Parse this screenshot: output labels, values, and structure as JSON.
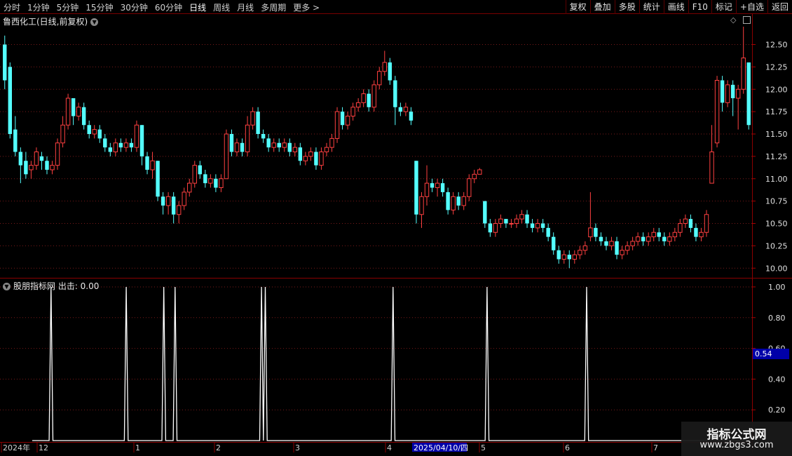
{
  "toolbar": {
    "periods": [
      "分时",
      "1分钟",
      "5分钟",
      "15分钟",
      "30分钟",
      "60分钟",
      "日线",
      "周线",
      "月线",
      "多周期",
      "更多 >"
    ],
    "active_period": "日线",
    "right_buttons": [
      "复权",
      "叠加",
      "多股",
      "统计",
      "画线",
      "F10",
      "标记",
      "+自选",
      "返回"
    ]
  },
  "main_chart": {
    "title": "鲁西化工(日线,前复权)",
    "y_ticks": [
      "12.50",
      "12.25",
      "12.00",
      "11.75",
      "11.50",
      "11.25",
      "11.00",
      "10.75",
      "10.50",
      "10.25",
      "10.00"
    ]
  },
  "indicator": {
    "title": "股朋指标网 出击: 0.00",
    "y_ticks": [
      "1.00",
      "0.80",
      "0.60",
      "0.40",
      "0.20"
    ],
    "current_value_tag": "0.54"
  },
  "date_axis": {
    "labels": [
      "2024年",
      "12",
      "1",
      "2",
      "3",
      "4",
      "5",
      "6",
      "7"
    ],
    "highlight_date": "2025/04/10/四"
  },
  "watermark": {
    "line1": "指标公式网",
    "line2": "www.zbgs3.com"
  },
  "chart_data": [
    {
      "type": "candlestick",
      "title": "鲁西化工(日线,前复权)",
      "ylim": [
        9.9,
        12.7
      ],
      "up_color": "#ff4040",
      "down_color": "#54ffff",
      "candles": [
        [
          12.5,
          12.1,
          12.6,
          12.0
        ],
        [
          12.25,
          11.5,
          12.3,
          11.45
        ],
        [
          11.55,
          11.3,
          11.7,
          11.25
        ],
        [
          11.3,
          11.15,
          11.35,
          10.95
        ],
        [
          11.2,
          11.05,
          11.3,
          11.0
        ],
        [
          11.1,
          11.15,
          11.2,
          11.0
        ],
        [
          11.15,
          11.3,
          11.35,
          11.1
        ],
        [
          11.25,
          11.2,
          11.3,
          11.1
        ],
        [
          11.2,
          11.1,
          11.25,
          11.05
        ],
        [
          11.1,
          11.15,
          11.2,
          11.05
        ],
        [
          11.15,
          11.4,
          11.45,
          11.1
        ],
        [
          11.4,
          11.6,
          11.7,
          11.35
        ],
        [
          11.6,
          11.9,
          11.95,
          11.55
        ],
        [
          11.9,
          11.7,
          11.9,
          11.6
        ],
        [
          11.7,
          11.8,
          11.85,
          11.65
        ],
        [
          11.8,
          11.6,
          11.85,
          11.55
        ],
        [
          11.6,
          11.5,
          11.65,
          11.45
        ],
        [
          11.5,
          11.55,
          11.6,
          11.45
        ],
        [
          11.55,
          11.45,
          11.6,
          11.4
        ],
        [
          11.45,
          11.35,
          11.5,
          11.3
        ],
        [
          11.35,
          11.3,
          11.4,
          11.25
        ],
        [
          11.3,
          11.4,
          11.45,
          11.25
        ],
        [
          11.4,
          11.35,
          11.45,
          11.3
        ],
        [
          11.35,
          11.4,
          11.45,
          11.3
        ],
        [
          11.4,
          11.35,
          11.45,
          11.3
        ],
        [
          11.35,
          11.6,
          11.65,
          11.3
        ],
        [
          11.6,
          11.25,
          11.6,
          11.15
        ],
        [
          11.25,
          11.1,
          11.3,
          11.05
        ],
        [
          11.1,
          11.2,
          11.3,
          11.0
        ],
        [
          11.2,
          10.8,
          11.2,
          10.75
        ],
        [
          10.8,
          10.7,
          10.85,
          10.6
        ],
        [
          10.7,
          10.8,
          10.85,
          10.6
        ],
        [
          10.8,
          10.6,
          10.85,
          10.5
        ],
        [
          10.6,
          10.7,
          10.75,
          10.5
        ],
        [
          10.7,
          10.85,
          10.9,
          10.65
        ],
        [
          10.85,
          10.95,
          11.0,
          10.8
        ],
        [
          10.95,
          11.15,
          11.2,
          10.9
        ],
        [
          11.15,
          11.05,
          11.2,
          11.0
        ],
        [
          11.05,
          10.95,
          11.1,
          10.9
        ],
        [
          10.95,
          11.0,
          11.05,
          10.9
        ],
        [
          11.0,
          10.9,
          11.05,
          10.85
        ],
        [
          10.9,
          11.0,
          11.05,
          10.85
        ],
        [
          11.0,
          11.5,
          11.55,
          11.0
        ],
        [
          11.5,
          11.3,
          11.55,
          11.25
        ],
        [
          11.3,
          11.4,
          11.45,
          11.25
        ],
        [
          11.4,
          11.3,
          11.45,
          11.25
        ],
        [
          11.3,
          11.6,
          11.7,
          11.25
        ],
        [
          11.6,
          11.75,
          11.8,
          11.55
        ],
        [
          11.75,
          11.5,
          11.8,
          11.45
        ],
        [
          11.5,
          11.45,
          11.55,
          11.4
        ],
        [
          11.45,
          11.35,
          11.5,
          11.3
        ],
        [
          11.35,
          11.4,
          11.45,
          11.3
        ],
        [
          11.4,
          11.35,
          11.45,
          11.3
        ],
        [
          11.35,
          11.4,
          11.45,
          11.3
        ],
        [
          11.4,
          11.3,
          11.45,
          11.25
        ],
        [
          11.3,
          11.35,
          11.4,
          11.25
        ],
        [
          11.35,
          11.2,
          11.4,
          11.15
        ],
        [
          11.2,
          11.25,
          11.3,
          11.15
        ],
        [
          11.25,
          11.3,
          11.35,
          11.2
        ],
        [
          11.3,
          11.15,
          11.35,
          11.1
        ],
        [
          11.15,
          11.3,
          11.35,
          11.1
        ],
        [
          11.3,
          11.35,
          11.4,
          11.25
        ],
        [
          11.35,
          11.45,
          11.5,
          11.3
        ],
        [
          11.45,
          11.75,
          11.8,
          11.4
        ],
        [
          11.75,
          11.6,
          11.8,
          11.55
        ],
        [
          11.6,
          11.7,
          11.75,
          11.55
        ],
        [
          11.7,
          11.8,
          11.85,
          11.65
        ],
        [
          11.8,
          11.85,
          11.9,
          11.75
        ],
        [
          11.85,
          11.95,
          12.0,
          11.8
        ],
        [
          11.95,
          11.8,
          12.0,
          11.75
        ],
        [
          11.8,
          12.05,
          12.1,
          11.75
        ],
        [
          12.05,
          12.2,
          12.25,
          12.0
        ],
        [
          12.2,
          12.3,
          12.43,
          12.15
        ],
        [
          12.3,
          12.1,
          12.35,
          12.05
        ],
        [
          12.1,
          11.8,
          12.15,
          11.6
        ],
        [
          11.8,
          11.75,
          11.85,
          11.7
        ],
        [
          11.75,
          11.8,
          11.85,
          11.7
        ],
        [
          11.75,
          11.65,
          11.8,
          11.6
        ],
        [
          11.2,
          10.6,
          11.2,
          10.5
        ],
        [
          10.6,
          10.8,
          10.85,
          10.45
        ],
        [
          10.8,
          10.95,
          11.15,
          10.7
        ],
        [
          10.95,
          10.9,
          11.0,
          10.85
        ],
        [
          10.9,
          10.95,
          11.0,
          10.8
        ],
        [
          10.95,
          10.85,
          11.0,
          10.8
        ],
        [
          10.85,
          10.65,
          10.9,
          10.6
        ],
        [
          10.65,
          10.8,
          10.85,
          10.6
        ],
        [
          10.8,
          10.7,
          10.85,
          10.65
        ],
        [
          10.7,
          10.8,
          10.85,
          10.65
        ],
        [
          10.8,
          11.0,
          11.05,
          10.75
        ],
        [
          11.0,
          11.05,
          11.1,
          10.95
        ],
        [
          11.05,
          11.1,
          11.12,
          11.05
        ],
        [
          10.75,
          10.5,
          10.75,
          10.45
        ],
        [
          10.5,
          10.4,
          10.55,
          10.35
        ],
        [
          10.4,
          10.5,
          10.55,
          10.35
        ],
        [
          10.5,
          10.55,
          10.6,
          10.45
        ],
        [
          10.55,
          10.5,
          10.55,
          10.45
        ],
        [
          10.5,
          10.5,
          10.55,
          10.45
        ],
        [
          10.5,
          10.55,
          10.6,
          10.45
        ],
        [
          10.55,
          10.6,
          10.65,
          10.5
        ],
        [
          10.6,
          10.5,
          10.65,
          10.45
        ],
        [
          10.5,
          10.45,
          10.55,
          10.4
        ],
        [
          10.45,
          10.5,
          10.55,
          10.4
        ],
        [
          10.5,
          10.45,
          10.55,
          10.4
        ],
        [
          10.45,
          10.35,
          10.5,
          10.3
        ],
        [
          10.35,
          10.2,
          10.4,
          10.15
        ],
        [
          10.2,
          10.1,
          10.25,
          10.05
        ],
        [
          10.1,
          10.15,
          10.2,
          10.05
        ],
        [
          10.15,
          10.1,
          10.2,
          10.0
        ],
        [
          10.1,
          10.15,
          10.2,
          10.05
        ],
        [
          10.15,
          10.2,
          10.25,
          10.1
        ],
        [
          10.2,
          10.25,
          10.3,
          10.15
        ],
        [
          10.35,
          10.45,
          10.85,
          10.3
        ],
        [
          10.45,
          10.35,
          10.5,
          10.3
        ],
        [
          10.35,
          10.3,
          10.4,
          10.25
        ],
        [
          10.3,
          10.25,
          10.35,
          10.2
        ],
        [
          10.25,
          10.3,
          10.35,
          10.2
        ],
        [
          10.3,
          10.15,
          10.35,
          10.1
        ],
        [
          10.15,
          10.2,
          10.25,
          10.1
        ],
        [
          10.2,
          10.25,
          10.3,
          10.15
        ],
        [
          10.25,
          10.3,
          10.35,
          10.2
        ],
        [
          10.3,
          10.35,
          10.4,
          10.25
        ],
        [
          10.35,
          10.3,
          10.4,
          10.25
        ],
        [
          10.3,
          10.35,
          10.4,
          10.25
        ],
        [
          10.35,
          10.4,
          10.45,
          10.3
        ],
        [
          10.4,
          10.35,
          10.45,
          10.3
        ],
        [
          10.35,
          10.3,
          10.4,
          10.25
        ],
        [
          10.3,
          10.35,
          10.4,
          10.25
        ],
        [
          10.35,
          10.4,
          10.45,
          10.3
        ],
        [
          10.4,
          10.5,
          10.55,
          10.35
        ],
        [
          10.5,
          10.55,
          10.6,
          10.45
        ],
        [
          10.55,
          10.45,
          10.6,
          10.4
        ],
        [
          10.45,
          10.35,
          10.5,
          10.3
        ],
        [
          10.35,
          10.4,
          10.45,
          10.3
        ],
        [
          10.4,
          10.6,
          10.65,
          10.35
        ],
        [
          10.95,
          11.3,
          11.6,
          10.95
        ],
        [
          11.4,
          12.1,
          12.15,
          11.35
        ],
        [
          12.1,
          11.85,
          12.15,
          11.75
        ],
        [
          11.85,
          12.05,
          12.1,
          11.8
        ],
        [
          12.05,
          11.9,
          12.1,
          11.7
        ],
        [
          11.9,
          12.0,
          12.05,
          11.55
        ],
        [
          12.0,
          12.35,
          12.7,
          11.95
        ],
        [
          12.3,
          11.6,
          12.3,
          11.55
        ]
      ]
    },
    {
      "type": "line",
      "title": "股朋指标网 出击",
      "ylim": [
        0,
        1.05
      ],
      "line_color": "#ffffff",
      "values": [
        0,
        0,
        0,
        0,
        0,
        0,
        0,
        0,
        0,
        0,
        1,
        0,
        0,
        0,
        0,
        0,
        0,
        0,
        0,
        0,
        0,
        0,
        0,
        0,
        0,
        0,
        0,
        0,
        0,
        0,
        0,
        0,
        0,
        0,
        0,
        0,
        0,
        0,
        0,
        0,
        0,
        0,
        0,
        0,
        0,
        0,
        0,
        0,
        0,
        0,
        1,
        0,
        0,
        0,
        0,
        0,
        0,
        0,
        0,
        0,
        0,
        0,
        0,
        0,
        0,
        0,
        0,
        0,
        0,
        0,
        1,
        0,
        0,
        0,
        0,
        0,
        1,
        0,
        0,
        0,
        0,
        0,
        0,
        0,
        0,
        0,
        0,
        0,
        0,
        0,
        0,
        0,
        0,
        0,
        0,
        0,
        0,
        0,
        0,
        0,
        0,
        0,
        0,
        0,
        0,
        0,
        0,
        0,
        0,
        0,
        0,
        0,
        0,
        0,
        0,
        0,
        0,
        0,
        0,
        0,
        0,
        0,
        1,
        0,
        1,
        0,
        0,
        0,
        0,
        0,
        0,
        0,
        0,
        0,
        0,
        0,
        0,
        0,
        0,
        0,
        0,
        0,
        0,
        0,
        0,
        0,
        0,
        0,
        0,
        0,
        0,
        0,
        0,
        0,
        0,
        0,
        0,
        0,
        0,
        0,
        0,
        0,
        0,
        0,
        0,
        0,
        0,
        0,
        0,
        0,
        0,
        0,
        0,
        0,
        0,
        0,
        0,
        0,
        0,
        0,
        0,
        0,
        0,
        0,
        0,
        0,
        0,
        0,
        0,
        0,
        0,
        0,
        1,
        0,
        0,
        0,
        0,
        0,
        0,
        0,
        0,
        0,
        0,
        0,
        0,
        0,
        0,
        0,
        0,
        0,
        0,
        0,
        0,
        0,
        0,
        0,
        0,
        0,
        0,
        0,
        0,
        0,
        0,
        0,
        0,
        0,
        0,
        0,
        0,
        0,
        0,
        0,
        0,
        0,
        0,
        0,
        0,
        0,
        0,
        0,
        0,
        0,
        1,
        0,
        0,
        0,
        0,
        0,
        0,
        0,
        0,
        0,
        0,
        0,
        0,
        0,
        0,
        0,
        0,
        0,
        0,
        0,
        0,
        0,
        0,
        0,
        0,
        0,
        0,
        0,
        0,
        0,
        0,
        0,
        0,
        0,
        0,
        0,
        0,
        0,
        0,
        0,
        0,
        0,
        0,
        0,
        0,
        0,
        0,
        0,
        0,
        0,
        0,
        0,
        0,
        1,
        0,
        0,
        0,
        0,
        0,
        0,
        0,
        0,
        0,
        0,
        0,
        0,
        0,
        0,
        0,
        0,
        0,
        0,
        0,
        0,
        0,
        0,
        0,
        0,
        0,
        0,
        0,
        0,
        0,
        0,
        0,
        0,
        0,
        0,
        0,
        0,
        0,
        0,
        0,
        0,
        0,
        0,
        0,
        0,
        0,
        0,
        0,
        0,
        0,
        0,
        0,
        0,
        0,
        0,
        0,
        0,
        0,
        0,
        0,
        0,
        0,
        0,
        0,
        0,
        0,
        0,
        0,
        0,
        0,
        0,
        0,
        0,
        0,
        0,
        0,
        0,
        0,
        0,
        0,
        0,
        0,
        0,
        0,
        0,
        0,
        0,
        0
      ]
    }
  ]
}
